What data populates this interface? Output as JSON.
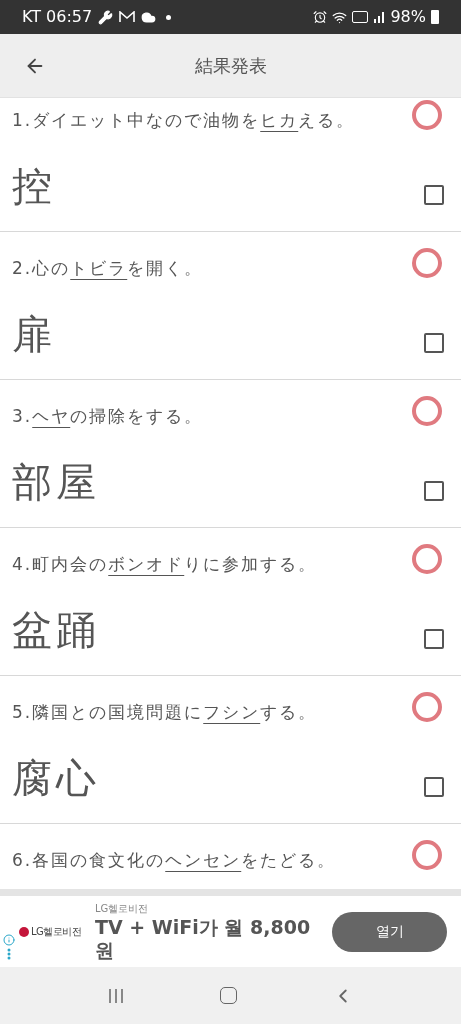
{
  "status_bar": {
    "left": "KT 06:57",
    "battery": "98%"
  },
  "header": {
    "title": "結果発表"
  },
  "items": [
    {
      "number": "1.",
      "before": "ダイエット中なので油物を",
      "underlined": "ヒカ",
      "after": "える。",
      "correct": true,
      "answer": "控",
      "checked": false
    },
    {
      "number": "2.",
      "before": "心の",
      "underlined": "トビラ",
      "after": "を開く。",
      "correct": true,
      "answer": "扉",
      "checked": false
    },
    {
      "number": "3.",
      "underlined": "ヘヤ",
      "after": "の掃除をする。",
      "correct": true,
      "answer": "部屋",
      "checked": false
    },
    {
      "number": "4.",
      "before": "町内会の",
      "underlined": "ボンオド",
      "after": "りに参加する。",
      "correct": true,
      "answer": "盆踊",
      "checked": false
    },
    {
      "number": "5.",
      "before": "隣国との国境問題に",
      "underlined": "フシン",
      "after": "する。",
      "correct": true,
      "answer": "腐心",
      "checked": false
    },
    {
      "number": "6.",
      "before": "各国の食文化の",
      "underlined": "ヘンセン",
      "after": "をたどる。",
      "correct": true
    }
  ],
  "ad": {
    "brand": "LG헬로비전",
    "advertiser": "LG헬로비전",
    "headline": "TV + WiFi가 월 8,800 원",
    "button": "열기"
  }
}
